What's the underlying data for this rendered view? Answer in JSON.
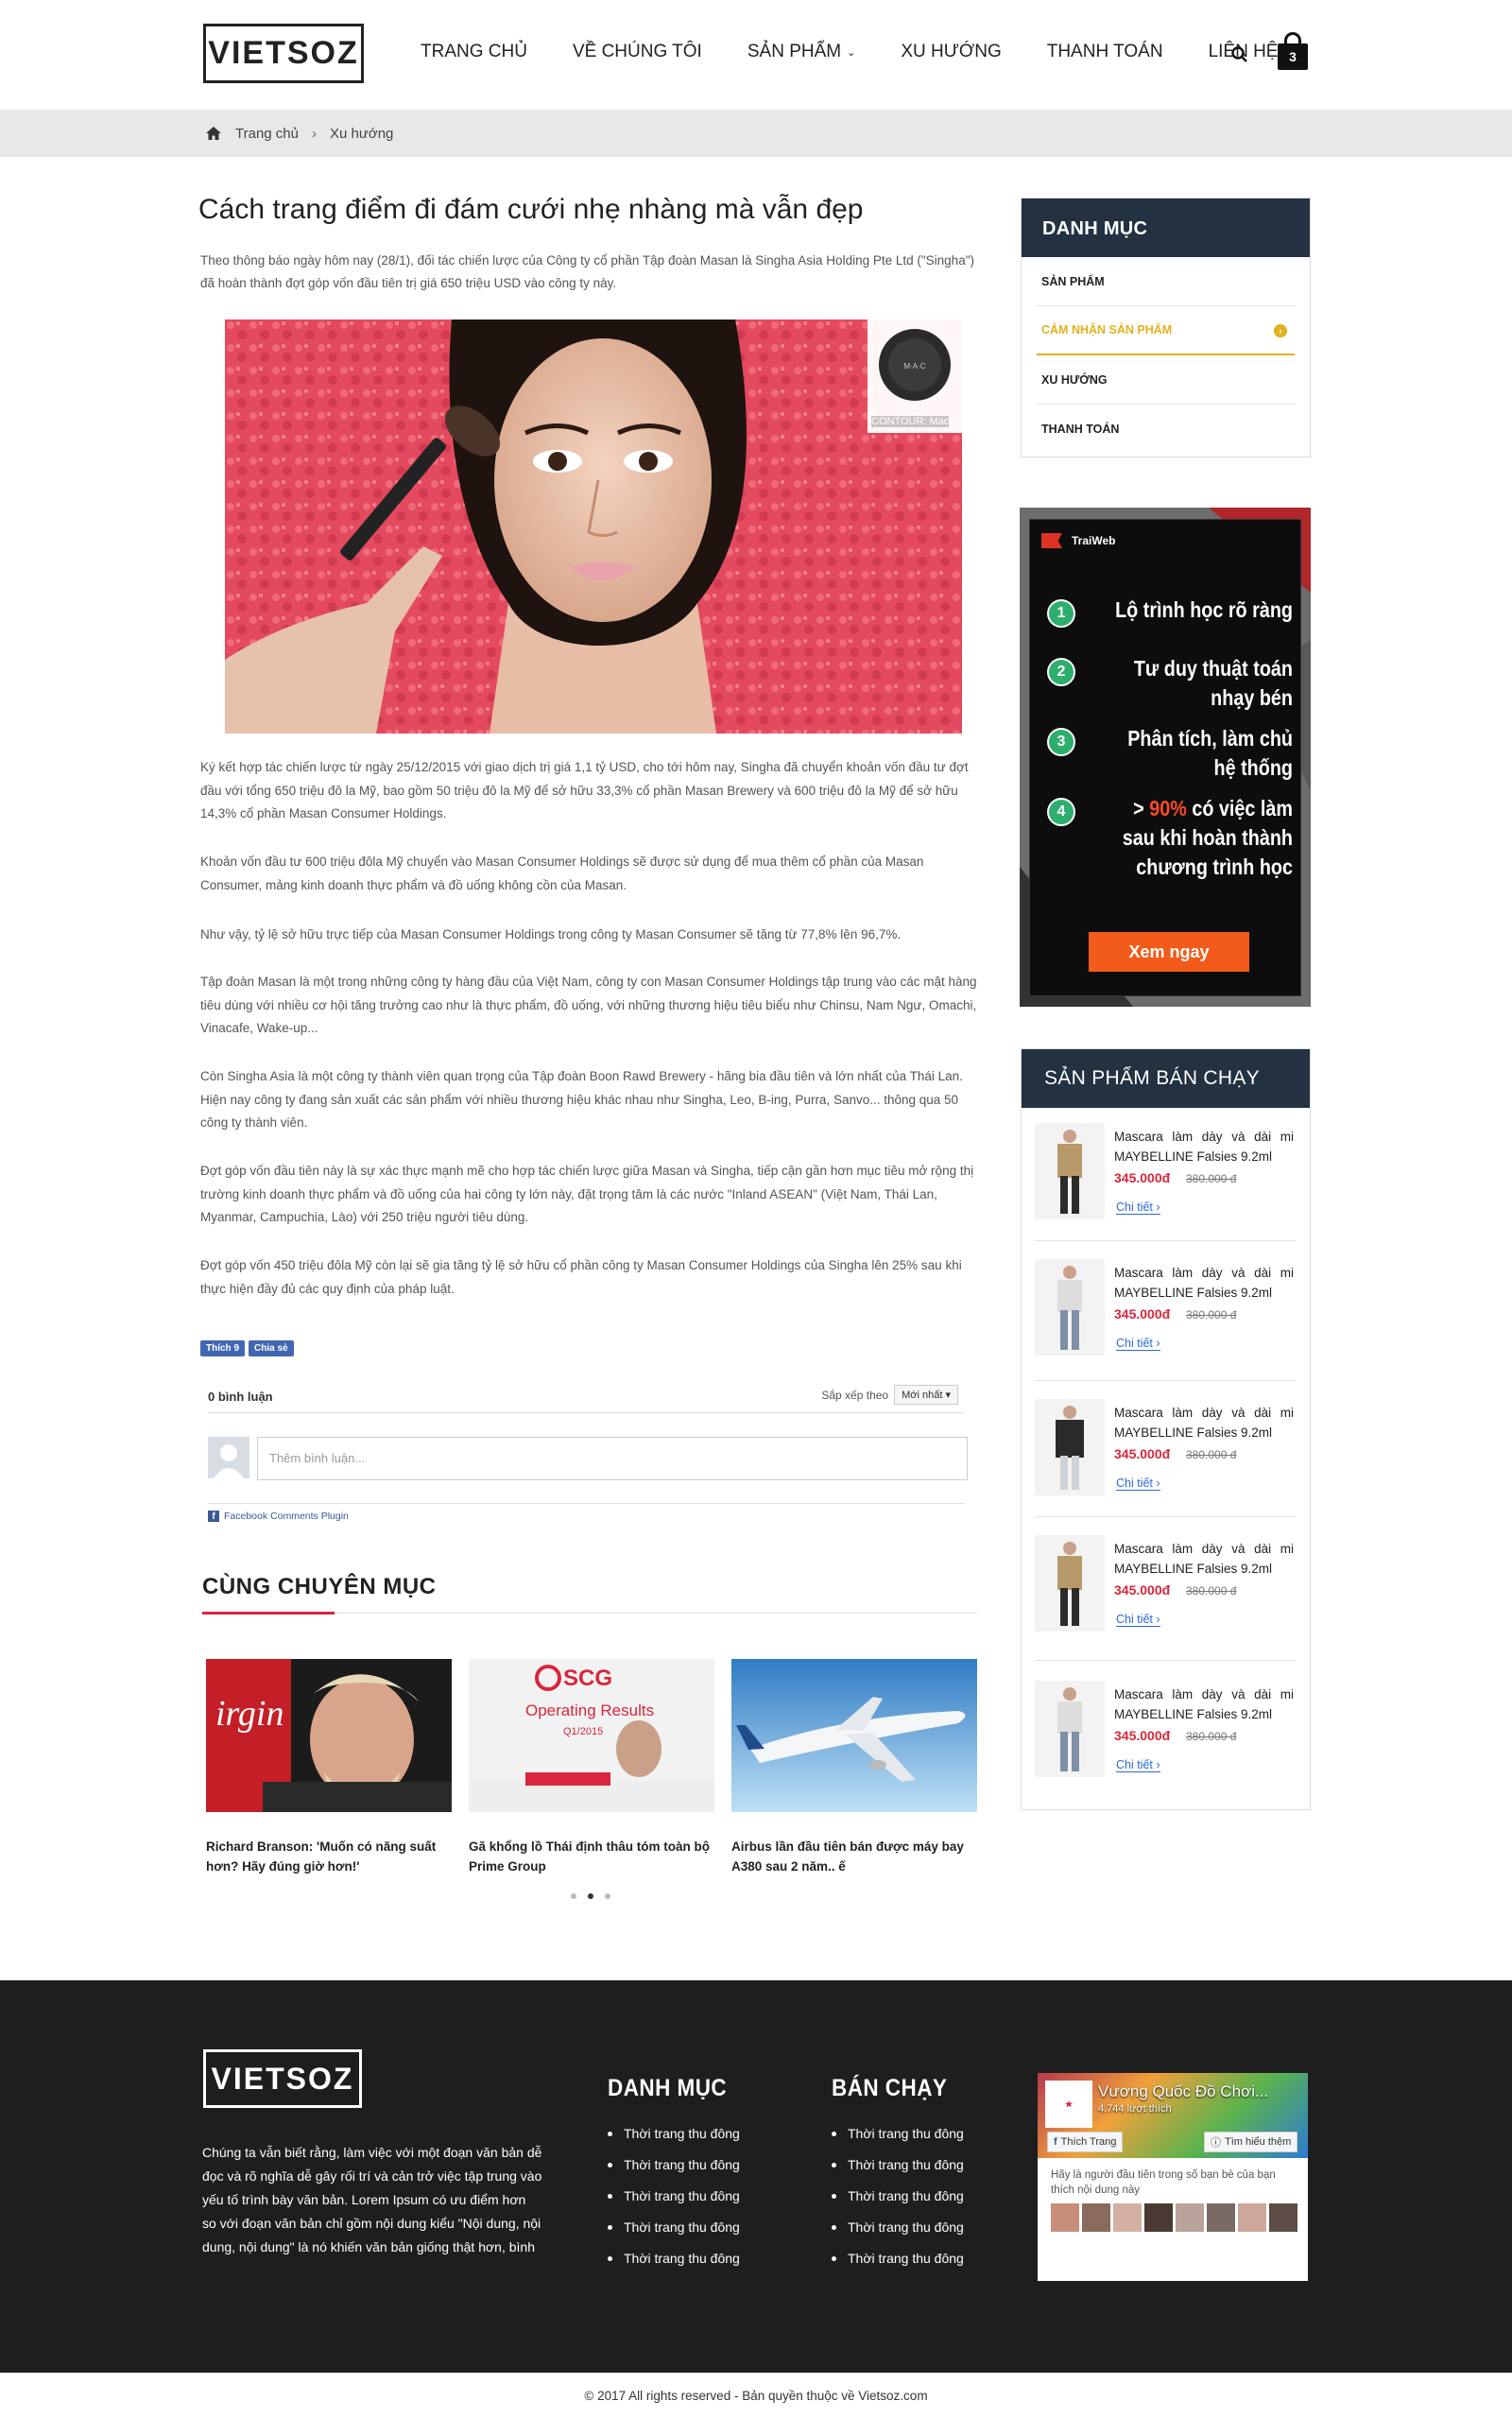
{
  "header": {
    "logo": "VIETSOZ",
    "nav": [
      {
        "label": "TRANG CHỦ"
      },
      {
        "label": "VỀ CHÚNG TÔI"
      },
      {
        "label": "SẢN PHẨM"
      },
      {
        "label": "XU HƯỚNG"
      },
      {
        "label": "THANH TOÁN"
      },
      {
        "label": "LIÊN HỆ"
      }
    ],
    "cart_count": "3"
  },
  "breadcrumb": {
    "home": "Trang chủ",
    "current": "Xu hướng"
  },
  "article": {
    "title": "Cách trang điểm đi đám cưới nhẹ nhàng mà vẫn đẹp",
    "intro": "Theo thông báo ngày hôm nay (28/1), đối tác chiến lược của Công ty cổ phần Tập đoàn Masan là Singha Asia Holding Pte Ltd (\"Singha\") đã hoàn thành đợt góp vốn đầu tiên trị giá 650 triệu USD vào công ty này.",
    "image_caption": "CONTOUR: Mac",
    "paragraphs": [
      "Ký kết hợp tác chiến lược từ ngày 25/12/2015 với giao dịch trị giá 1,1 tỷ USD, cho tới hôm nay, Singha đã chuyển khoản vốn đầu tư đợt đầu với tổng 650 triệu đô la Mỹ, bao gồm 50 triệu đô la Mỹ để sở hữu 33,3% cổ phần Masan Brewery và 600 triệu đô la Mỹ để sở hữu 14,3% cổ phần Masan Consumer Holdings.",
      "Khoản vốn đầu tư 600 triệu đôla Mỹ chuyển vào Masan Consumer Holdings sẽ được sử dụng để mua thêm cổ phần của Masan Consumer, mảng kinh doanh thực phẩm và đồ uống không cồn của Masan.",
      "Như vậy, tỷ lệ sở hữu trực tiếp của Masan Consumer Holdings trong công ty Masan Consumer sẽ tăng từ 77,8% lên 96,7%.",
      "Tập đoàn Masan là một trong những công ty hàng đầu của Việt Nam, công ty con Masan Consumer Holdings tập trung vào các mặt hàng tiêu dùng với nhiều cơ hội tăng trưởng cao như là thực phẩm, đồ uống, với những thương hiệu tiêu biểu như Chinsu, Nam Ngư, Omachi, Vinacafe, Wake-up...",
      "Còn Singha Asia là một công ty thành viên quan trọng của Tập đoàn Boon Rawd Brewery - hãng bia đầu tiên và lớn nhất của Thái Lan. Hiện nay công ty đang sản xuất các sản phẩm với nhiều thương hiệu khác nhau như Singha, Leo, B-ing, Purra, Sanvo... thông qua 50 công ty thành viên.",
      "Đợt góp vốn đầu tiên này là sự xác thực mạnh mẽ cho hợp tác chiến lược giữa Masan và Singha, tiếp cận gần hơn mục tiêu mở rộng thị trường kinh doanh thực phẩm và đồ uống của hai công ty lớn này, đặt trọng tâm là các nước \"Inland ASEAN\" (Việt Nam, Thái Lan, Myanmar, Campuchia, Lào) với 250 triệu người tiêu dùng.",
      "Đợt góp vốn 450 triệu đôla Mỹ còn lại sẽ gia tăng tỷ lệ sở hữu cổ phần công ty Masan Consumer Holdings của Singha lên 25% sau khi thực hiện đầy đủ các quy định của pháp luật."
    ],
    "like_label": "Thích 9",
    "share_label": "Chia sẻ"
  },
  "comments": {
    "count": "0 bình luận",
    "sort_label": "Sắp xếp theo",
    "sort_value": "Mới nhất",
    "placeholder": "Thêm bình luận...",
    "plugin": "Facebook Comments Plugin"
  },
  "related": {
    "title": "CÙNG CHUYÊN MỤC",
    "items": [
      {
        "title": "Richard Branson: 'Muốn có năng suất hơn? Hãy đúng giờ hơn!'"
      },
      {
        "title": "Gã khổng lồ Thái định thâu tóm toàn bộ Prime Group"
      },
      {
        "title": "Airbus lần đầu tiên bán được máy bay A380 sau 2 năm.. ế"
      }
    ]
  },
  "sidebar": {
    "category_title": "DANH MỤC",
    "categories": [
      {
        "label": "SẢN PHẨM"
      },
      {
        "label": "CẢM NHẬN SẢN PHẨM"
      },
      {
        "label": "XU HƯỚNG"
      },
      {
        "label": "THANH TOÁN"
      }
    ],
    "ad": {
      "brand": "TraiWeb",
      "items": [
        {
          "num": "1",
          "text": "Lộ trình học rõ ràng"
        },
        {
          "num": "2",
          "text": "Tư duy thuật toán nhạy bén"
        },
        {
          "num": "3",
          "text": "Phân tích, làm chủ hệ thống"
        },
        {
          "num": "4",
          "prefix": "> ",
          "highlight": "90%",
          "text": " có việc làm sau khi hoàn thành chương trình học"
        }
      ],
      "cta": "Xem ngay"
    },
    "best_title": "SẢN PHẨM BÁN CHẠY",
    "products": [
      {
        "name": "Mascara làm dày và dài mi MAYBELLINE Falsies 9.2ml",
        "price": "345.000đ",
        "old_price": "380.000 đ",
        "more": "Chi tiết"
      },
      {
        "name": "Mascara làm dày và dài mi MAYBELLINE Falsies 9.2ml",
        "price": "345.000đ",
        "old_price": "380.000 đ",
        "more": "Chi tiết"
      },
      {
        "name": "Mascara làm dày và dài mi MAYBELLINE Falsies 9.2ml",
        "price": "345.000đ",
        "old_price": "380.000 đ",
        "more": "Chi tiết"
      },
      {
        "name": "Mascara làm dày và dài mi MAYBELLINE Falsies 9.2ml",
        "price": "345.000đ",
        "old_price": "380.000 đ",
        "more": "Chi tiết"
      },
      {
        "name": "Mascara làm dày và dài mi MAYBELLINE Falsies 9.2ml",
        "price": "345.000đ",
        "old_price": "380.000 đ",
        "more": "Chi tiết"
      }
    ]
  },
  "footer": {
    "logo": "VIETSOZ",
    "about": "Chúng ta vẫn biết rằng, làm việc với một đoạn văn bản dễ đọc và rõ nghĩa dễ gây rối trí và cản trở việc tập trung vào yếu tố trình bày văn bản. Lorem Ipsum có ưu điểm hơn so với đoạn văn bản chỉ gồm nội dung kiểu \"Nội dung, nội dung, nội dung\" là nó khiến văn bản giống thật hơn, bình",
    "col1_title": "DANH MỤC",
    "col1_items": [
      "Thời trang thu đông",
      "Thời trang thu đông",
      "Thời trang thu đông",
      "Thời trang thu đông",
      "Thời trang thu đông"
    ],
    "col2_title": "BÁN CHẠY",
    "col2_items": [
      "Thời trang thu đông",
      "Thời trang thu đông",
      "Thời trang thu đông",
      "Thời trang thu đông",
      "Thời trang thu đông"
    ],
    "fb_page": {
      "name": "Vương Quốc Đồ Chơi...",
      "likes": "4.744 lượt thích",
      "like_btn": "Thích Trang",
      "info_btn": "Tìm hiểu thêm",
      "text": "Hãy là người đầu tiên trong số bạn bè của bạn thích nội dung này"
    },
    "copyright": "© 2017  All rights reserved -  Bản quyền thuộc về Vietsoz.com"
  },
  "colors": {
    "sidebar_head": "#233140",
    "accent_yellow": "#e2b11d",
    "accent_red": "#d9263c",
    "footer_bg": "#1e1e1e",
    "ad_green": "#2eae6d",
    "ad_orange": "#f25b1a"
  }
}
